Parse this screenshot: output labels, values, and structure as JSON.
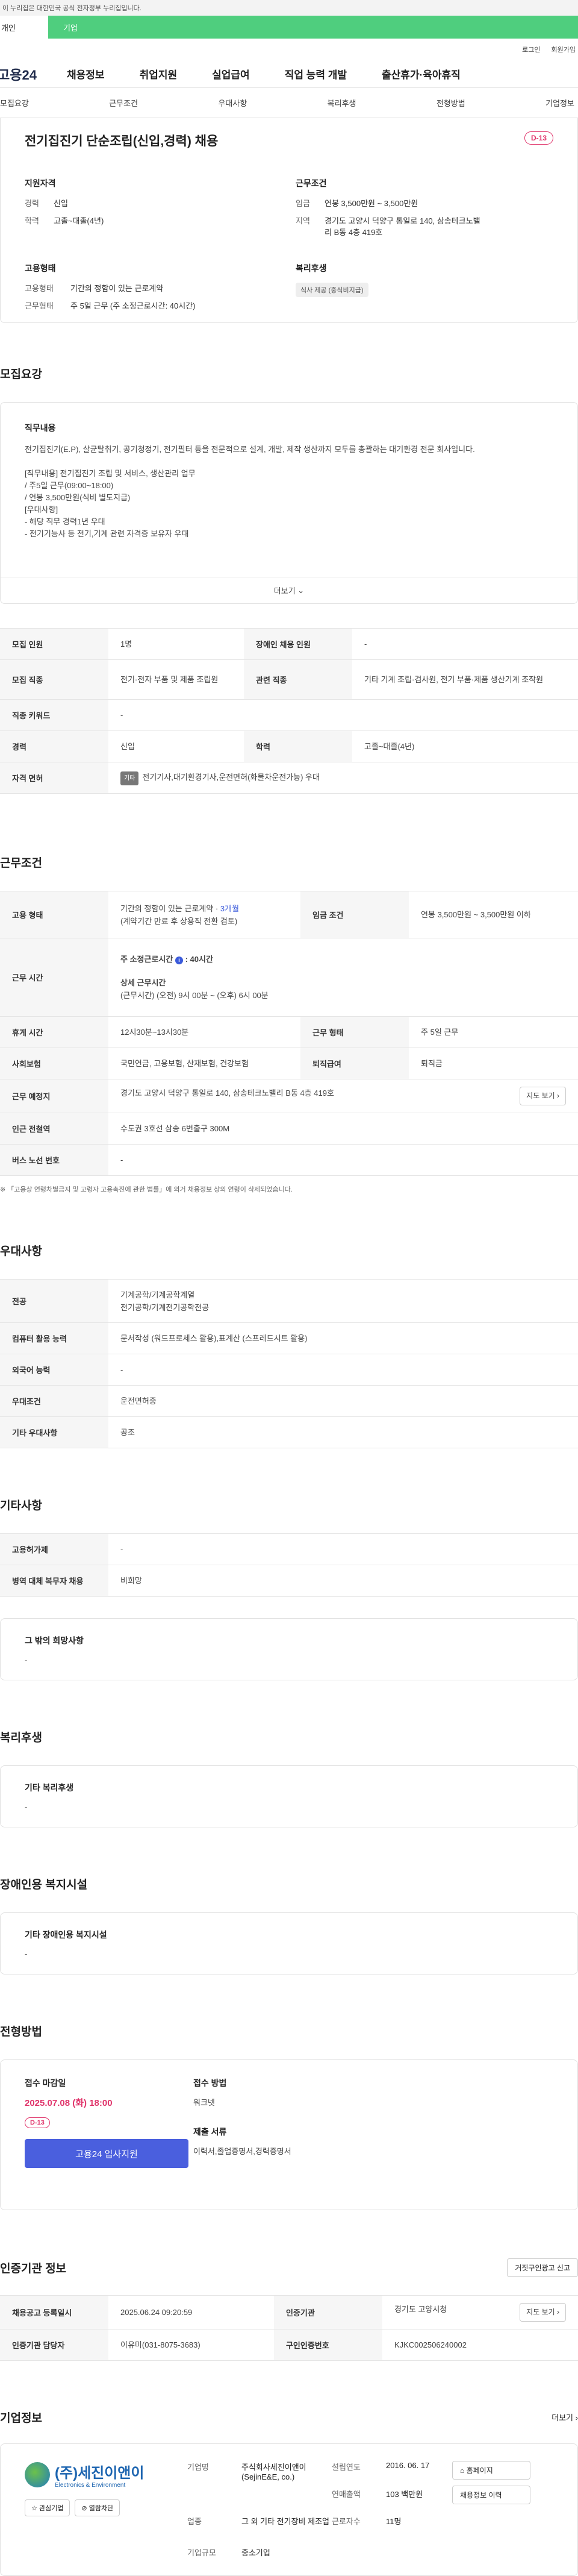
{
  "gov_banner": "이 누리집은 대한민국 공식 전자정부 누리집입니다.",
  "top_tabs": {
    "person": "개인",
    "company": "기업"
  },
  "util_links": [
    "로그인",
    "회원가입"
  ],
  "logo": "고용24",
  "gnb": [
    "채용정보",
    "취업지원",
    "실업급여",
    "직업 능력 개발",
    "출산휴가·육아휴직"
  ],
  "subnav": [
    "모집요강",
    "근무조건",
    "우대사항",
    "복리후생",
    "전형방법",
    "기업정보"
  ],
  "summary": {
    "title": "전기집진기 단순조립(신입,경력) 채용",
    "dday": "D-13",
    "qual_title": "지원자격",
    "qual": [
      {
        "k": "경력",
        "v": "신입"
      },
      {
        "k": "학력",
        "v": "고졸~대졸(4년)"
      }
    ],
    "cond_title": "근무조건",
    "cond": [
      {
        "k": "임금",
        "v": "연봉 3,500만원 ~ 3,500만원"
      },
      {
        "k": "지역",
        "v": "경기도 고양시 덕양구 통일로 140, 삼송테크노밸리 B동 4층 419호"
      }
    ],
    "form_title": "고용형태",
    "form": [
      {
        "k": "고용형태",
        "v": "기간의 정함이 있는 근로계약"
      },
      {
        "k": "근무형태",
        "v": "주 5일 근무 (주 소정근로시간: 40시간)"
      }
    ],
    "benefit_title": "복리후생",
    "benefit_chip": "식사 제공 (중식비지급)"
  },
  "recruit": {
    "section_title": "모집요강",
    "duty_title": "직무내용",
    "duty_lines": [
      "전기집진기(E.P), 살균탈취기, 공기청정기, 전기필터 등을 전문적으로 설계, 개발, 제작 생산까지 모두를 총괄하는 대기환경 전문 회사입니다.",
      "",
      "[직무내용] 전기집진기 조립 및 서비스, 생산관리 업무",
      "/ 주5일 근무(09:00~18:00)",
      "/ 연봉 3,500만원(식비 별도지급)",
      "[우대사항]",
      "- 해당 직무 경력1년 우대",
      "- 전기기능사 등 전기,기계 관련 자격증 보유자 우대"
    ],
    "more": "더보기",
    "rows": [
      {
        "k1": "모집 인원",
        "v1": "1명",
        "k2": "장애인 채용 인원",
        "v2": "-"
      },
      {
        "k1": "모집 직종",
        "v1": "전기·전자 부품 및 제품 조립원",
        "k2": "관련 직종",
        "v2": "기타 기계 조립·검사원, 전기 부품·제품 생산기계 조작원"
      },
      {
        "k1": "직종 키워드",
        "v1": "-"
      },
      {
        "k1": "경력",
        "v1": "신입",
        "k2": "학력",
        "v2": "고졸~대졸(4년)"
      }
    ],
    "license_k": "자격 면허",
    "license_chip": "기타",
    "license_v": "전기기사,대기환경기사,운전면허(화물차운전가능) 우대"
  },
  "work": {
    "section_title": "근무조건",
    "rows": [
      {
        "k1": "고용 형태",
        "v1a": "기간의 정함이 있는 근로계약 · ",
        "v1hl": "3개월",
        "v1b": "(계약기간 만료 후 상용직 전환 검토)",
        "k2": "임금 조건",
        "v2": "연봉 3,500만원 ~ 3,500만원 이하"
      }
    ],
    "hours_k": "근무 시간",
    "hours_week": "주 소정근로시간",
    "hours_week_v": "40시간",
    "hours_detail_t": "상세 근무시간",
    "hours_detail": "(근무시간) (오전) 9시 00분 ~ (오후) 6시 00분",
    "rest": {
      "k1": "휴게 시간",
      "v1": "12시30분~13시30분",
      "k2": "근무 형태",
      "v2": "주 5일 근무"
    },
    "insur": {
      "k1": "사회보험",
      "v1": "국민연금, 고용보험, 산재보험, 건강보험",
      "k2": "퇴직급여",
      "v2": "퇴직금"
    },
    "place": {
      "k1": "근무 예정지",
      "v1": "경기도 고양시 덕양구 통일로 140, 삼송테크노밸리 B동 4층 419호",
      "btn": "지도 보기"
    },
    "subway": {
      "k1": "인근 전철역",
      "v1": "수도권 3호선 삼송 6번출구 300M"
    },
    "bus": {
      "k1": "버스 노선 번호",
      "v1": "-"
    },
    "note": "※ 「고용상 연령차별금지 및 고령자 고용촉진에 관한 법률」에 의거 채용정보 상의 연령이 삭제되었습니다."
  },
  "pref": {
    "section_title": "우대사항",
    "rows": [
      {
        "k": "전공",
        "v": [
          "기계공학/기계공학계열",
          "전기공학/기계전기공학전공"
        ]
      },
      {
        "k": "컴퓨터 활용 능력",
        "v": [
          "문서작성 (워드프로세스 활용),표계산 (스프레드시트 활용)"
        ]
      },
      {
        "k": "외국어 능력",
        "v": [
          "-"
        ]
      },
      {
        "k": "우대조건",
        "v": [
          "운전면허증"
        ]
      },
      {
        "k": "기타 우대사항",
        "v": [
          "공조"
        ]
      }
    ]
  },
  "etc": {
    "section_title": "기타사항",
    "rows": [
      {
        "k": "고용허가제",
        "v": "-"
      },
      {
        "k": "병역 대체 복무자 채용",
        "v": "비희망"
      }
    ],
    "wish_title": "그 밖의 희망사항",
    "wish_v": "-"
  },
  "welfare": {
    "section_title": "복리후생",
    "title": "기타 복리후생",
    "v": "-"
  },
  "disabled": {
    "section_title": "장애인용 복지시설",
    "title": "기타 장애인용 복지시설",
    "v": "-"
  },
  "process": {
    "section_title": "전형방법",
    "deadline_t": "접수 마감일",
    "deadline": "2025.07.08 (화) 18:00",
    "dday": "D-13",
    "apply": "고용24 입사지원",
    "method_t": "접수 방법",
    "method_v": "워크넷",
    "docs_t": "제출 서류",
    "docs_v": "이력서,졸업증명서,경력증명서"
  },
  "agency": {
    "section_title": "인증기관 정보",
    "report_btn": "거짓구인광고 신고",
    "rows": [
      {
        "k1": "채용공고 등록일시",
        "v1": "2025.06.24 09:20:59",
        "k2": "인증기관",
        "v2": "경기도 고양시청",
        "btn": "지도 보기"
      },
      {
        "k1": "인증기관 담당자",
        "v1": "이유미(031-8075-3683)",
        "k2": "구인인증번호",
        "v2": "KJKC002506240002"
      }
    ]
  },
  "company": {
    "section_title": "기업정보",
    "more": "더보기",
    "logo_ko": "(주)세진이앤이",
    "logo_en": "Electronics & Environment",
    "btn_interest": "관심기업",
    "btn_block": "열람차단",
    "info": [
      {
        "k": "기업명",
        "v": "주식회사세진이앤이(SejinE&E, co.)"
      },
      {
        "k": "설립연도",
        "v": "2016. 06. 17"
      },
      {
        "k": "연매출액",
        "v": "103 백만원"
      },
      {
        "k": "근로자수",
        "v": "11명"
      },
      {
        "k": "업종",
        "v": "그 외 기타 전기장비 제조업"
      },
      {
        "k": "기업규모",
        "v": "중소기업"
      }
    ],
    "btn_home": "홈페이지",
    "btn_jobs": "채용정보 이력"
  }
}
